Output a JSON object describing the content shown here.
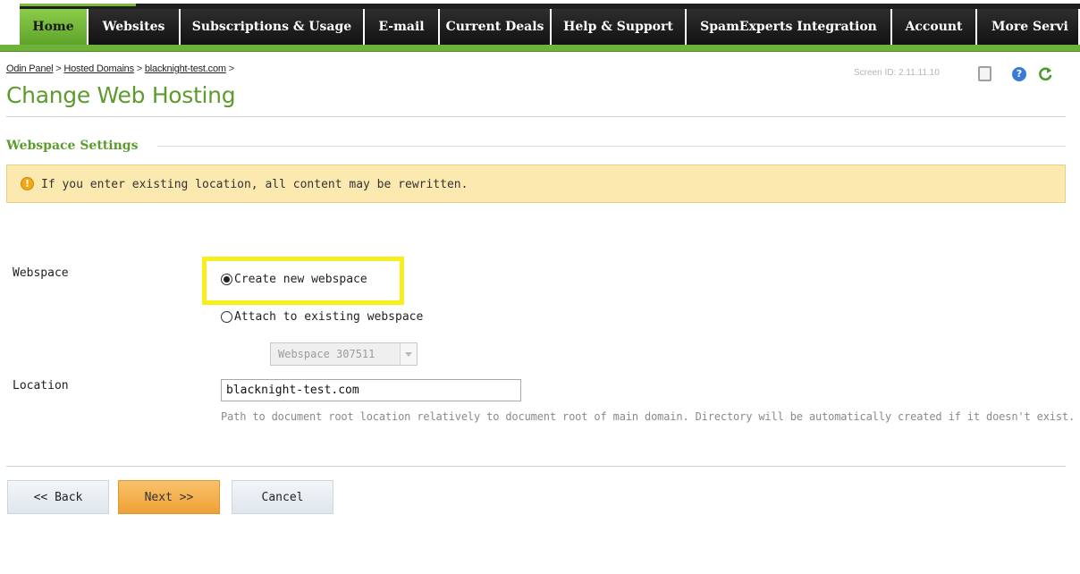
{
  "nav": {
    "tabs": [
      {
        "label": "Home",
        "active": true
      },
      {
        "label": "Websites"
      },
      {
        "label": "Subscriptions & Usage"
      },
      {
        "label": "E-mail"
      },
      {
        "label": "Current Deals"
      },
      {
        "label": "Help & Support"
      },
      {
        "label": "SpamExperts Integration"
      },
      {
        "label": "Account"
      },
      {
        "label": "More Servi"
      }
    ]
  },
  "breadcrumb": {
    "items": [
      "Odin Panel",
      "Hosted Domains",
      "blacknight-test.com"
    ],
    "separator": ">"
  },
  "page_title": "Change Web Hosting",
  "screen_id": "Screen ID:  2.11.11.10",
  "icons": {
    "document": "document-icon",
    "help": "help-icon",
    "refresh": "refresh-icon",
    "warning": "warning-icon",
    "help_glyph": "?",
    "warning_glyph": "!"
  },
  "section_title": "Webspace Settings",
  "warning_text": "If you enter existing location, all content may be rewritten.",
  "form": {
    "webspace_label": "Webspace",
    "option_new": "Create new webspace",
    "option_attach": "Attach to existing webspace",
    "selected_option": "new",
    "webspace_select_value": "Webspace 307511",
    "location_label": "Location",
    "location_value": "blacknight-test.com",
    "location_hint": "Path to document root location relatively to document root of main domain. Directory will be automatically created if it doesn't exist."
  },
  "buttons": {
    "back": "<< Back",
    "next": "Next >>",
    "cancel": "Cancel"
  },
  "colors": {
    "accent_green": "#5d9b2f",
    "active_tab": "#7cb83a",
    "warning_bg": "#fbe9b0",
    "highlight": "#f7ef1c",
    "next_button": "#eea137"
  }
}
